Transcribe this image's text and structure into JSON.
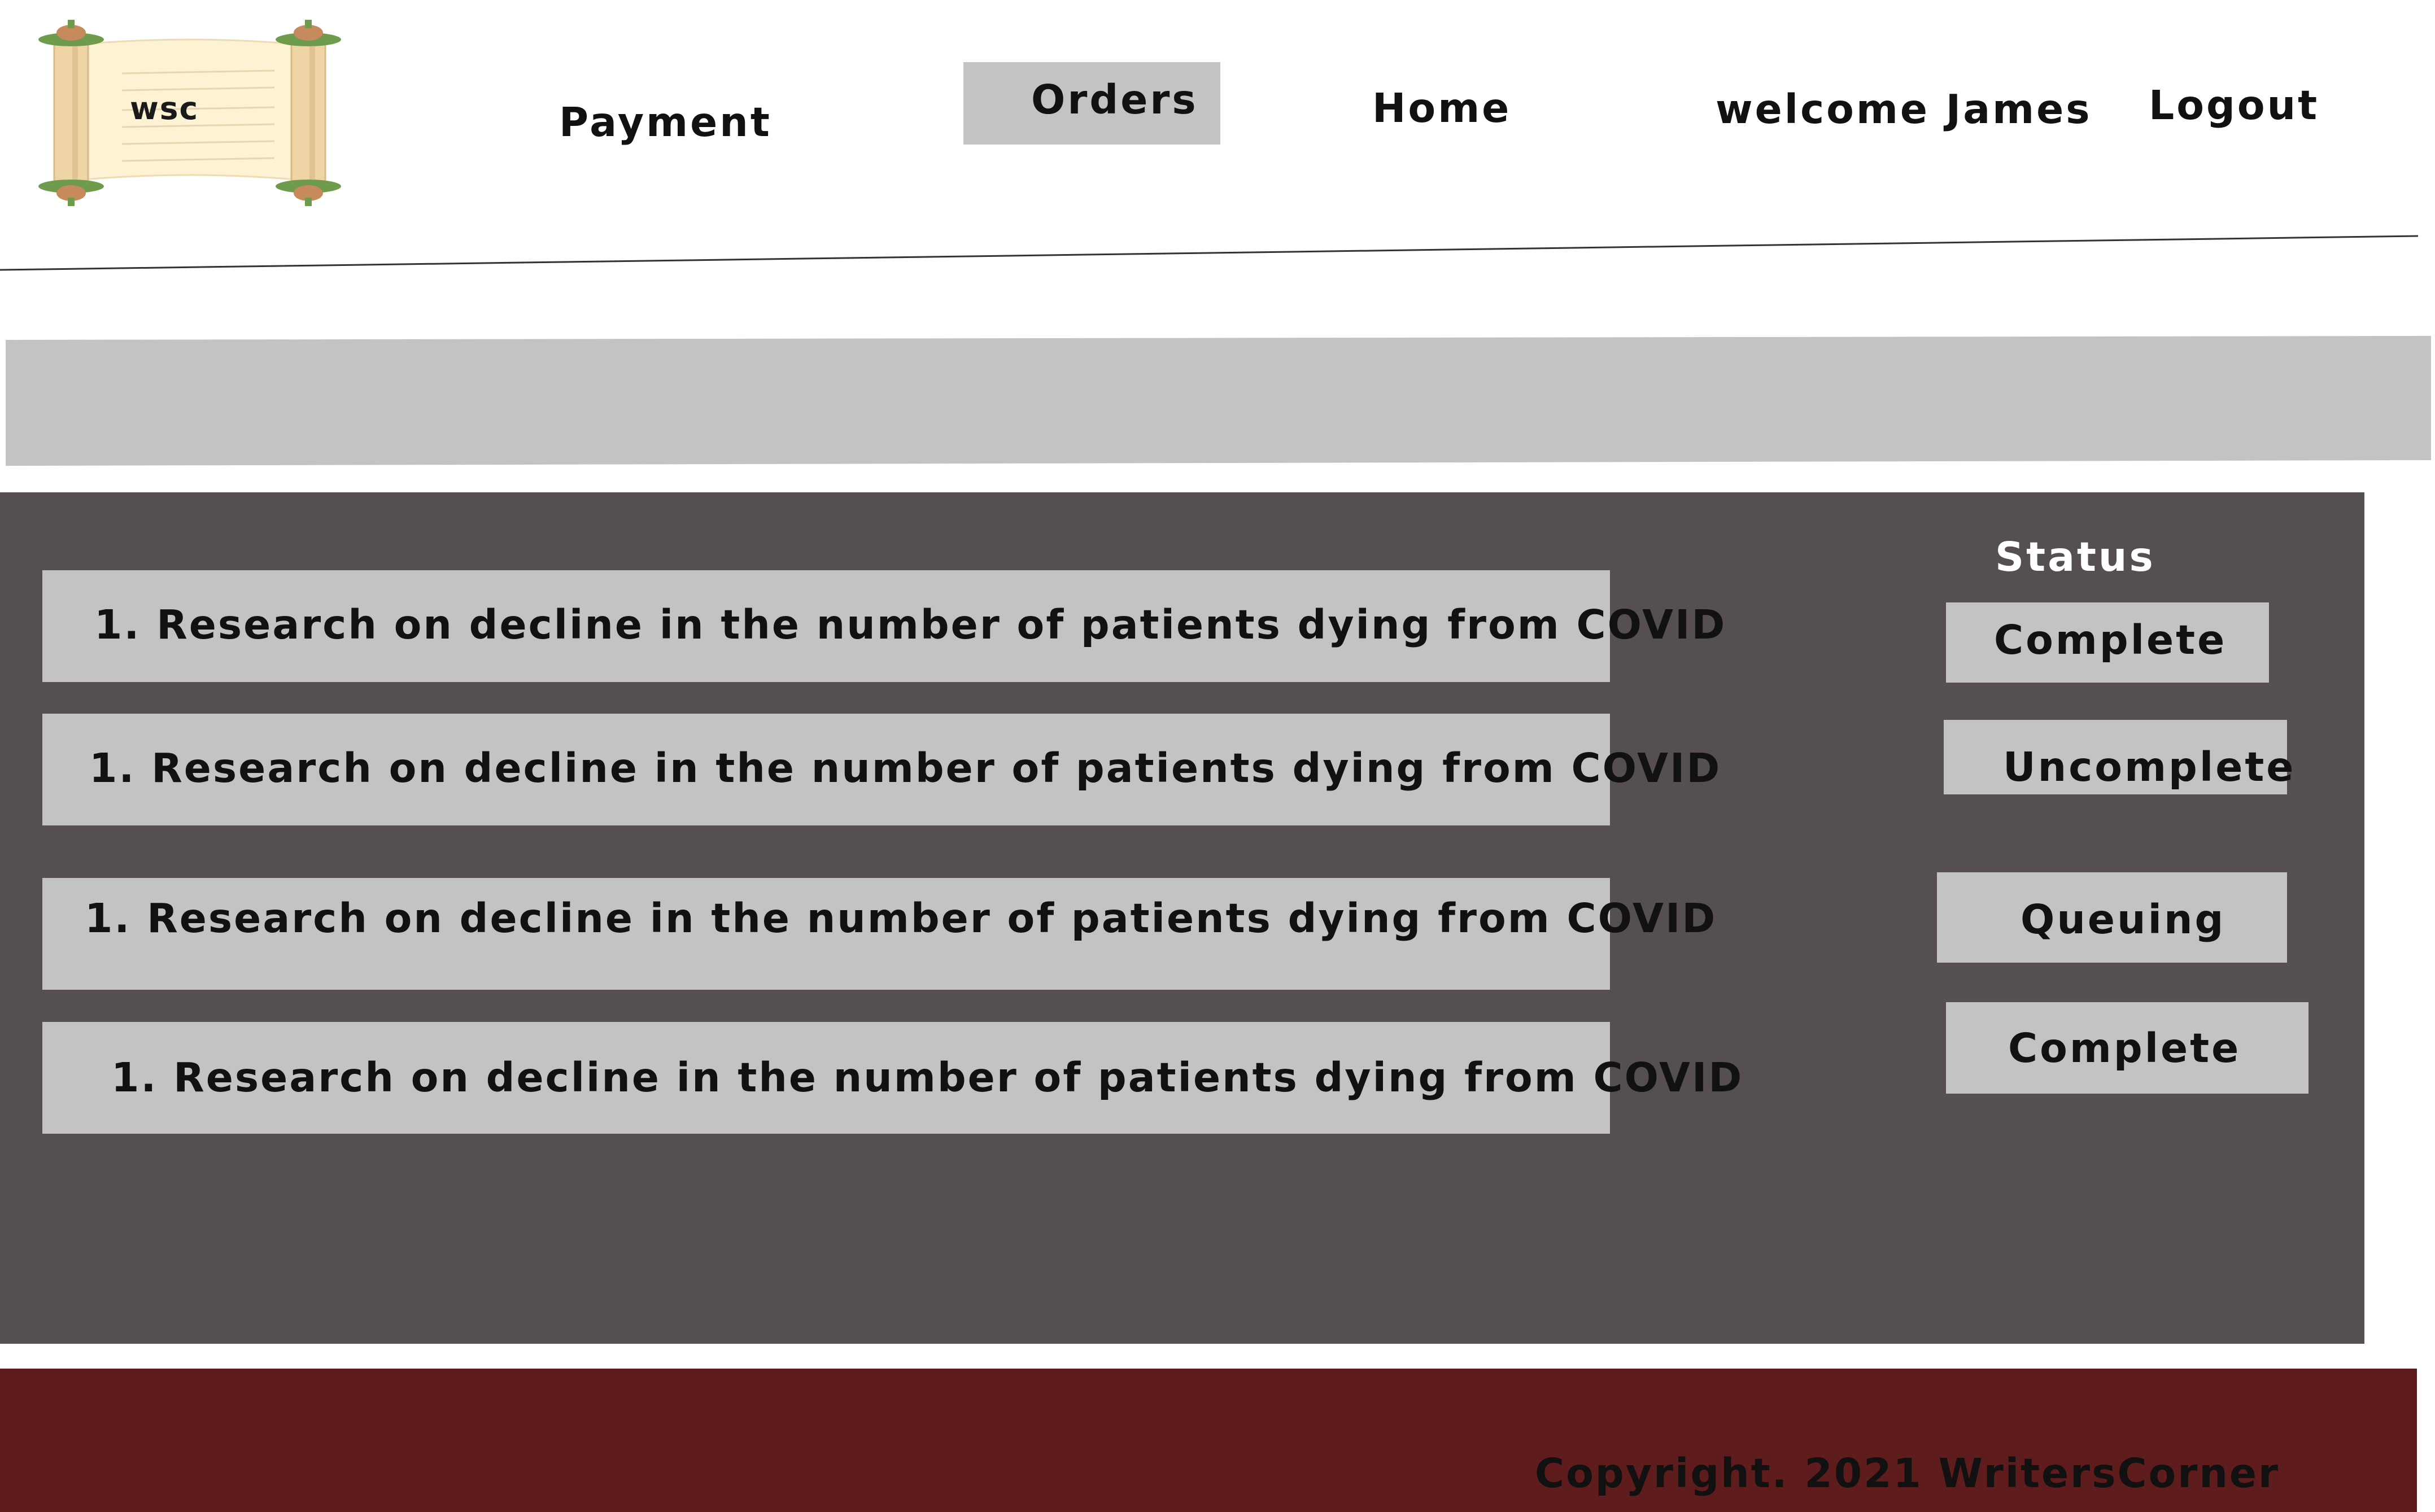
{
  "header": {
    "logo_text": "wsc",
    "nav": {
      "payment": "Payment",
      "orders": "Orders",
      "home": "Home",
      "welcome": "welcome James",
      "logout": "Logout"
    }
  },
  "orders": {
    "status_heading": "Status",
    "items": [
      {
        "title": "1. Research on decline in the number of patients dying from COVID",
        "status": "Complete"
      },
      {
        "title": "1. Research on decline in the number of patients dying from COVID",
        "status": "Uncomplete"
      },
      {
        "title": "1. Research on decline in the number of patients dying from COVID",
        "status": "Queuing"
      },
      {
        "title": "1. Research on decline in the number of patients dying from COVID",
        "status": "Complete"
      }
    ]
  },
  "footer": {
    "copyright": "Copyright. 2021 WritersCorner"
  },
  "colors": {
    "panel": "#554f4f",
    "row": "#c3c3c3",
    "footer": "#5e1c1d",
    "active_tab": "#c3c3c3"
  }
}
